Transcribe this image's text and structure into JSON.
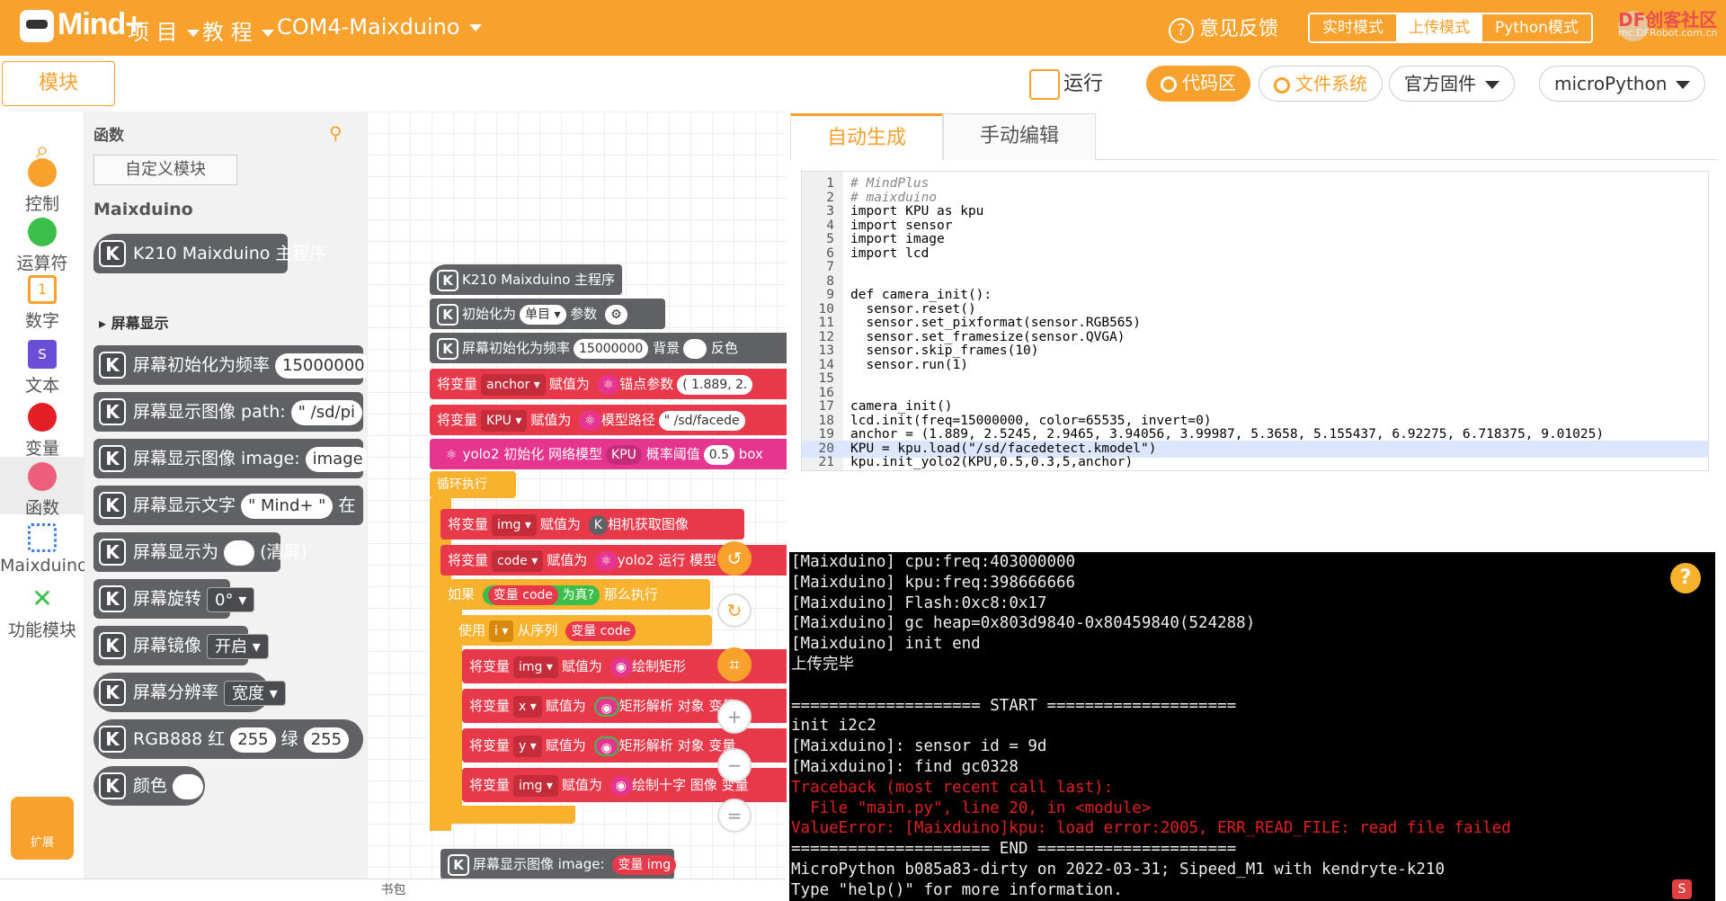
{
  "app": {
    "name": "Mind+"
  },
  "topbar": {
    "menu": [
      "项 目",
      "教 程",
      "COM4-Maixduino"
    ],
    "feedback": "意见反馈",
    "modes": [
      "实时模式",
      "上传模式",
      "Python模式"
    ],
    "corner_logo": "DF创客社区",
    "corner_sub": "mc.DFRobot.com.cn"
  },
  "toolbar": {
    "module_tab": "模块",
    "run": "运行",
    "code_area": "代码区",
    "file_system": "文件系统",
    "firmware": "官方固件",
    "language": "microPython"
  },
  "categories": [
    "控制",
    "运算符",
    "数字",
    "文本",
    "变量",
    "函数",
    "Maixduino",
    "功能模块",
    "扩展"
  ],
  "palette": {
    "title": "函数",
    "custom_module": "自定义模块",
    "header": "Maixduino",
    "main_block": "K210 Maixduino 主程序",
    "section": "屏幕显示",
    "blocks": [
      {
        "label": "屏幕初始化为频率",
        "slot": "15000000"
      },
      {
        "label": "屏幕显示图像 path:",
        "slot": "\" /sd/pi"
      },
      {
        "label": "屏幕显示图像 image:",
        "slot": "image"
      },
      {
        "label": "屏幕显示文字",
        "slot": "\" Mind+ \"",
        "tail": "在"
      },
      {
        "label": "屏幕显示为",
        "tail": "(清屏)"
      },
      {
        "label": "屏幕旋转",
        "slot": "0° ▾"
      },
      {
        "label": "屏幕镜像",
        "slot": "开启 ▾"
      },
      {
        "label": "屏幕分辨率",
        "slot": "宽度 ▾"
      },
      {
        "label": "RGB888 红",
        "slot": "255",
        "tail": "绿",
        "slot2": "255"
      },
      {
        "label": "颜色"
      }
    ]
  },
  "workspace": {
    "main": "K210 Maixduino 主程序",
    "init": "初始化为",
    "init_mode": "单目 ▾",
    "init_param": "参数",
    "screen_init": "屏幕初始化为频率",
    "screen_freq": "15000000",
    "bg": "背景",
    "invert": "反色",
    "set_var": "将变量",
    "assign": "赋值为",
    "anchor": "anchor ▾",
    "anchor_label": "锚点参数",
    "anchor_val": "( 1.889, 2.",
    "kpu": "KPU ▾",
    "model_path_label": "模型路径",
    "model_path": "\" /sd/facede",
    "yolo_init": "yolo2 初始化 网络模型",
    "yolo_kpu": "KPU",
    "threshold_label": "概率阈值",
    "threshold": "0.5",
    "box": "box",
    "loop": "循环执行",
    "img": "img ▾",
    "camera": "相机获取图像",
    "code": "code ▾",
    "yolo_run": "yolo2 运行",
    "model_suffix": "模型",
    "if": "如果",
    "var_code": "变量 code",
    "is_true": "为真?",
    "then": "那么执行",
    "use": "使用",
    "i": "i ▾",
    "from_seq": "从序列",
    "draw_rect": "绘制矩形",
    "x": "x ▾",
    "rect_parse": "矩形解析 对象",
    "y": "y ▾",
    "draw_cross": "绘制十字 图像",
    "var_abbr": "变量",
    "screen_show": "屏幕显示图像 image:",
    "var_img": "变量 img"
  },
  "bookbag": "书包",
  "editor": {
    "tabs": [
      "自动生成",
      "手动编辑"
    ],
    "lines": [
      {
        "n": "1",
        "t": "# MindPlus",
        "c": "cm"
      },
      {
        "n": "2",
        "t": "# maixduino",
        "c": "cm"
      },
      {
        "n": "3",
        "t": "import KPU as kpu"
      },
      {
        "n": "4",
        "t": "import sensor"
      },
      {
        "n": "5",
        "t": "import image"
      },
      {
        "n": "6",
        "t": "import lcd"
      },
      {
        "n": "7",
        "t": ""
      },
      {
        "n": "8",
        "t": ""
      },
      {
        "n": "9",
        "t": "def camera_init():"
      },
      {
        "n": "10",
        "t": "  sensor.reset()"
      },
      {
        "n": "11",
        "t": "  sensor.set_pixformat(sensor.RGB565)"
      },
      {
        "n": "12",
        "t": "  sensor.set_framesize(sensor.QVGA)"
      },
      {
        "n": "13",
        "t": "  sensor.skip_frames(10)"
      },
      {
        "n": "14",
        "t": "  sensor.run(1)"
      },
      {
        "n": "15",
        "t": ""
      },
      {
        "n": "16",
        "t": ""
      },
      {
        "n": "17",
        "t": "camera_init()"
      },
      {
        "n": "18",
        "t": "lcd.init(freq=15000000, color=65535, invert=0)"
      },
      {
        "n": "19",
        "t": "anchor = (1.889, 2.5245, 2.9465, 3.94056, 3.99987, 5.3658, 5.155437, 6.92275, 6.718375, 9.01025)"
      },
      {
        "n": "20",
        "t": "KPU = kpu.load(\"/sd/facedetect.kmodel\")",
        "hl": true
      },
      {
        "n": "21",
        "t": "kpu.init_yolo2(KPU,0.5,0.3,5,anchor)"
      }
    ]
  },
  "terminal": {
    "lines": [
      {
        "t": "[Maixduino] cpu:freq:403000000"
      },
      {
        "t": "[Maixduino] kpu:freq:398666666"
      },
      {
        "t": "[Maixduino] Flash:0xc8:0x17"
      },
      {
        "t": "[Maixduino] gc heap=0x803d9840-0x80459840(524288)"
      },
      {
        "t": "[Maixduino] init end"
      },
      {
        "t": "上传完毕"
      },
      {
        "t": ""
      },
      {
        "t": "==================== START ===================="
      },
      {
        "t": "init i2c2"
      },
      {
        "t": "[Maixduino]: sensor id = 9d"
      },
      {
        "t": "[Maixduino]: find gc0328"
      },
      {
        "t": "Traceback (most recent call last):",
        "err": true
      },
      {
        "t": "  File \"main.py\", line 20, in <module>",
        "err": true
      },
      {
        "t": "ValueError: [Maixduino]kpu: load error:2005, ERR_READ_FILE: read file failed",
        "err": true
      },
      {
        "t": "===================== END ====================="
      },
      {
        "t": "MicroPython b085a83-dirty on 2022-03-31; Sipeed_M1 with kendryte-k210"
      },
      {
        "t": "Type \"help()\" for more information."
      }
    ]
  },
  "colors": {
    "accent": "#f8a12d",
    "error": "#e02020"
  }
}
